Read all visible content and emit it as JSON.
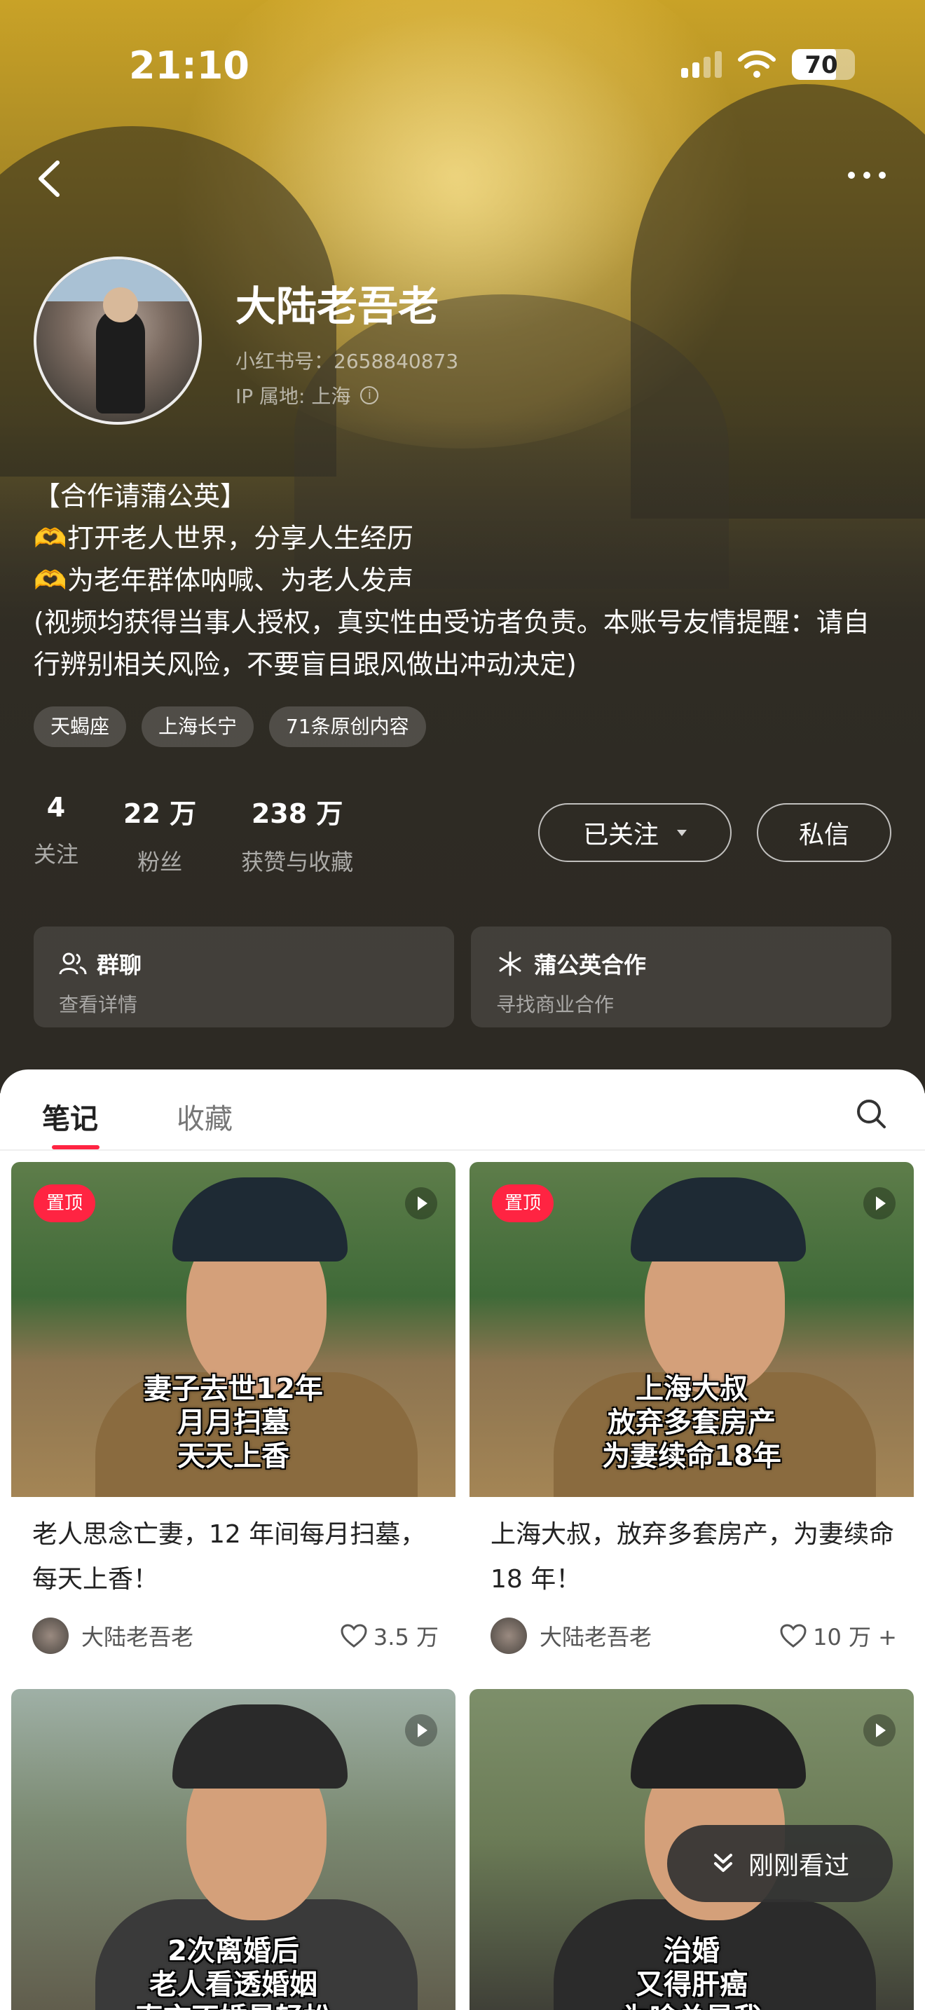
{
  "status_bar": {
    "time": "21:10",
    "battery": "70"
  },
  "profile": {
    "name": "大陆老吾老",
    "id_text": "小红书号：2658840873",
    "ip_text": "IP 属地: 上海",
    "bio": [
      "【合作请蒲公英】",
      "打开老人世界，分享人生经历",
      "为老年群体呐喊、为老人发声",
      "(视频均获得当事人授权，真实性由受访者负责。本账号友情提醒：请自",
      "行辨别相关风险，不要盲目跟风做出冲动决定)"
    ],
    "tags": [
      "天蝎座",
      "上海长宁",
      "71条原创内容"
    ],
    "stats": [
      {
        "value": "4",
        "label": "关注"
      },
      {
        "value": "22 万",
        "label": "粉丝"
      },
      {
        "value": "238 万",
        "label": "获赞与收藏"
      }
    ],
    "follow_label": "已关注",
    "message_label": "私信",
    "cards": [
      {
        "title": "群聊",
        "subtitle": "查看详情"
      },
      {
        "title": "蒲公英合作",
        "subtitle": "寻找商业合作"
      }
    ]
  },
  "tabs": {
    "notes": "笔记",
    "collections": "收藏"
  },
  "notes": [
    {
      "pinned": "置顶",
      "caption": [
        "妻子去世12年",
        "月月扫墓",
        "天天上香"
      ],
      "title": "老人思念亡妻，12 年间每月扫墓，每天上香！",
      "author": "大陆老吾老",
      "likes": "3.5 万"
    },
    {
      "pinned": "置顶",
      "caption": [
        "上海大叔",
        "放弃多套房产",
        "为妻续命18年"
      ],
      "title": "上海大叔，放弃多套房产，为妻续命 18 年！",
      "author": "大陆老吾老",
      "likes": "10 万 +"
    },
    {
      "caption": [
        "2次离婚后",
        "老人看透婚姻",
        "直言不婚最轻松"
      ]
    },
    {
      "caption": [
        "治婚",
        "又得肝癌",
        "为啥总是我"
      ]
    }
  ],
  "toast": {
    "label": "刚刚看过"
  },
  "colors": {
    "accent": "#ff2442",
    "hero_dark": "#2d2a24"
  }
}
